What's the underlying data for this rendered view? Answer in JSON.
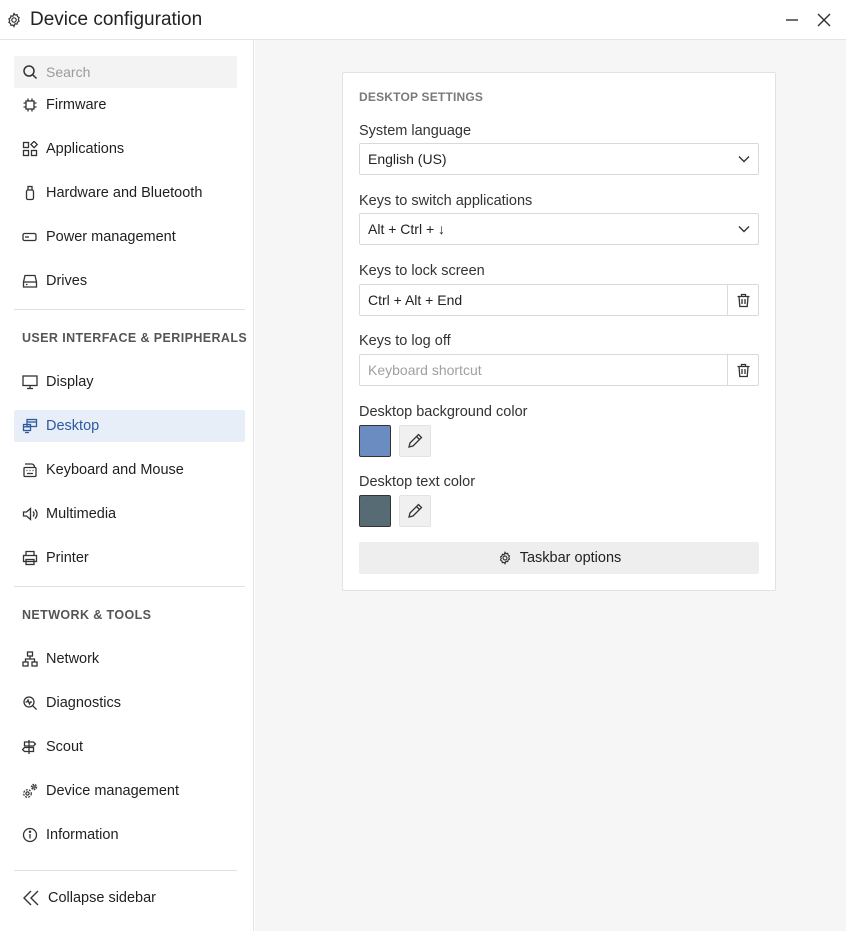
{
  "window": {
    "title": "Device configuration",
    "app_icon": "gear-icon",
    "controls": {
      "minimize_icon": "minimize-icon",
      "close_icon": "close-icon"
    }
  },
  "sidebar": {
    "search": {
      "placeholder": "Search",
      "value": ""
    },
    "group1_items": [
      {
        "label": "Firmware",
        "icon": "chip-icon"
      },
      {
        "label": "Applications",
        "icon": "apps-icon"
      },
      {
        "label": "Hardware and Bluetooth",
        "icon": "usb-icon"
      },
      {
        "label": "Power management",
        "icon": "battery-icon"
      },
      {
        "label": "Drives",
        "icon": "drive-icon"
      }
    ],
    "section2_title": "USER INTERFACE & PERIPHERALS",
    "group2_items": [
      {
        "label": "Display",
        "icon": "monitor-icon"
      },
      {
        "label": "Desktop",
        "icon": "desktop-windows-icon",
        "active": true
      },
      {
        "label": "Keyboard and Mouse",
        "icon": "keyboard-icon"
      },
      {
        "label": "Multimedia",
        "icon": "speaker-icon"
      },
      {
        "label": "Printer",
        "icon": "printer-icon"
      }
    ],
    "section3_title": "NETWORK & TOOLS",
    "group3_items": [
      {
        "label": "Network",
        "icon": "network-icon"
      },
      {
        "label": "Diagnostics",
        "icon": "diagnostics-icon"
      },
      {
        "label": "Scout",
        "icon": "signpost-icon"
      },
      {
        "label": "Device management",
        "icon": "gears-icon"
      },
      {
        "label": "Information",
        "icon": "info-icon"
      }
    ],
    "collapse_label": "Collapse sidebar",
    "active_color": "#2c5aa0",
    "active_bg": "#e8eef8"
  },
  "desktop_settings": {
    "title": "DESKTOP SETTINGS",
    "system_language": {
      "label": "System language",
      "value": "English (US)"
    },
    "switch_apps": {
      "label": "Keys to switch applications",
      "value": "Alt + Ctrl + ↓"
    },
    "lock_screen": {
      "label": "Keys to lock screen",
      "value": "Ctrl + Alt + End",
      "placeholder": "Keyboard shortcut"
    },
    "log_off": {
      "label": "Keys to log off",
      "value": "",
      "placeholder": "Keyboard shortcut"
    },
    "bg_color": {
      "label": "Desktop background color",
      "color": "#6b8cc0"
    },
    "text_color": {
      "label": "Desktop text color",
      "color": "#576b75"
    },
    "taskbar_button": "Taskbar options"
  }
}
